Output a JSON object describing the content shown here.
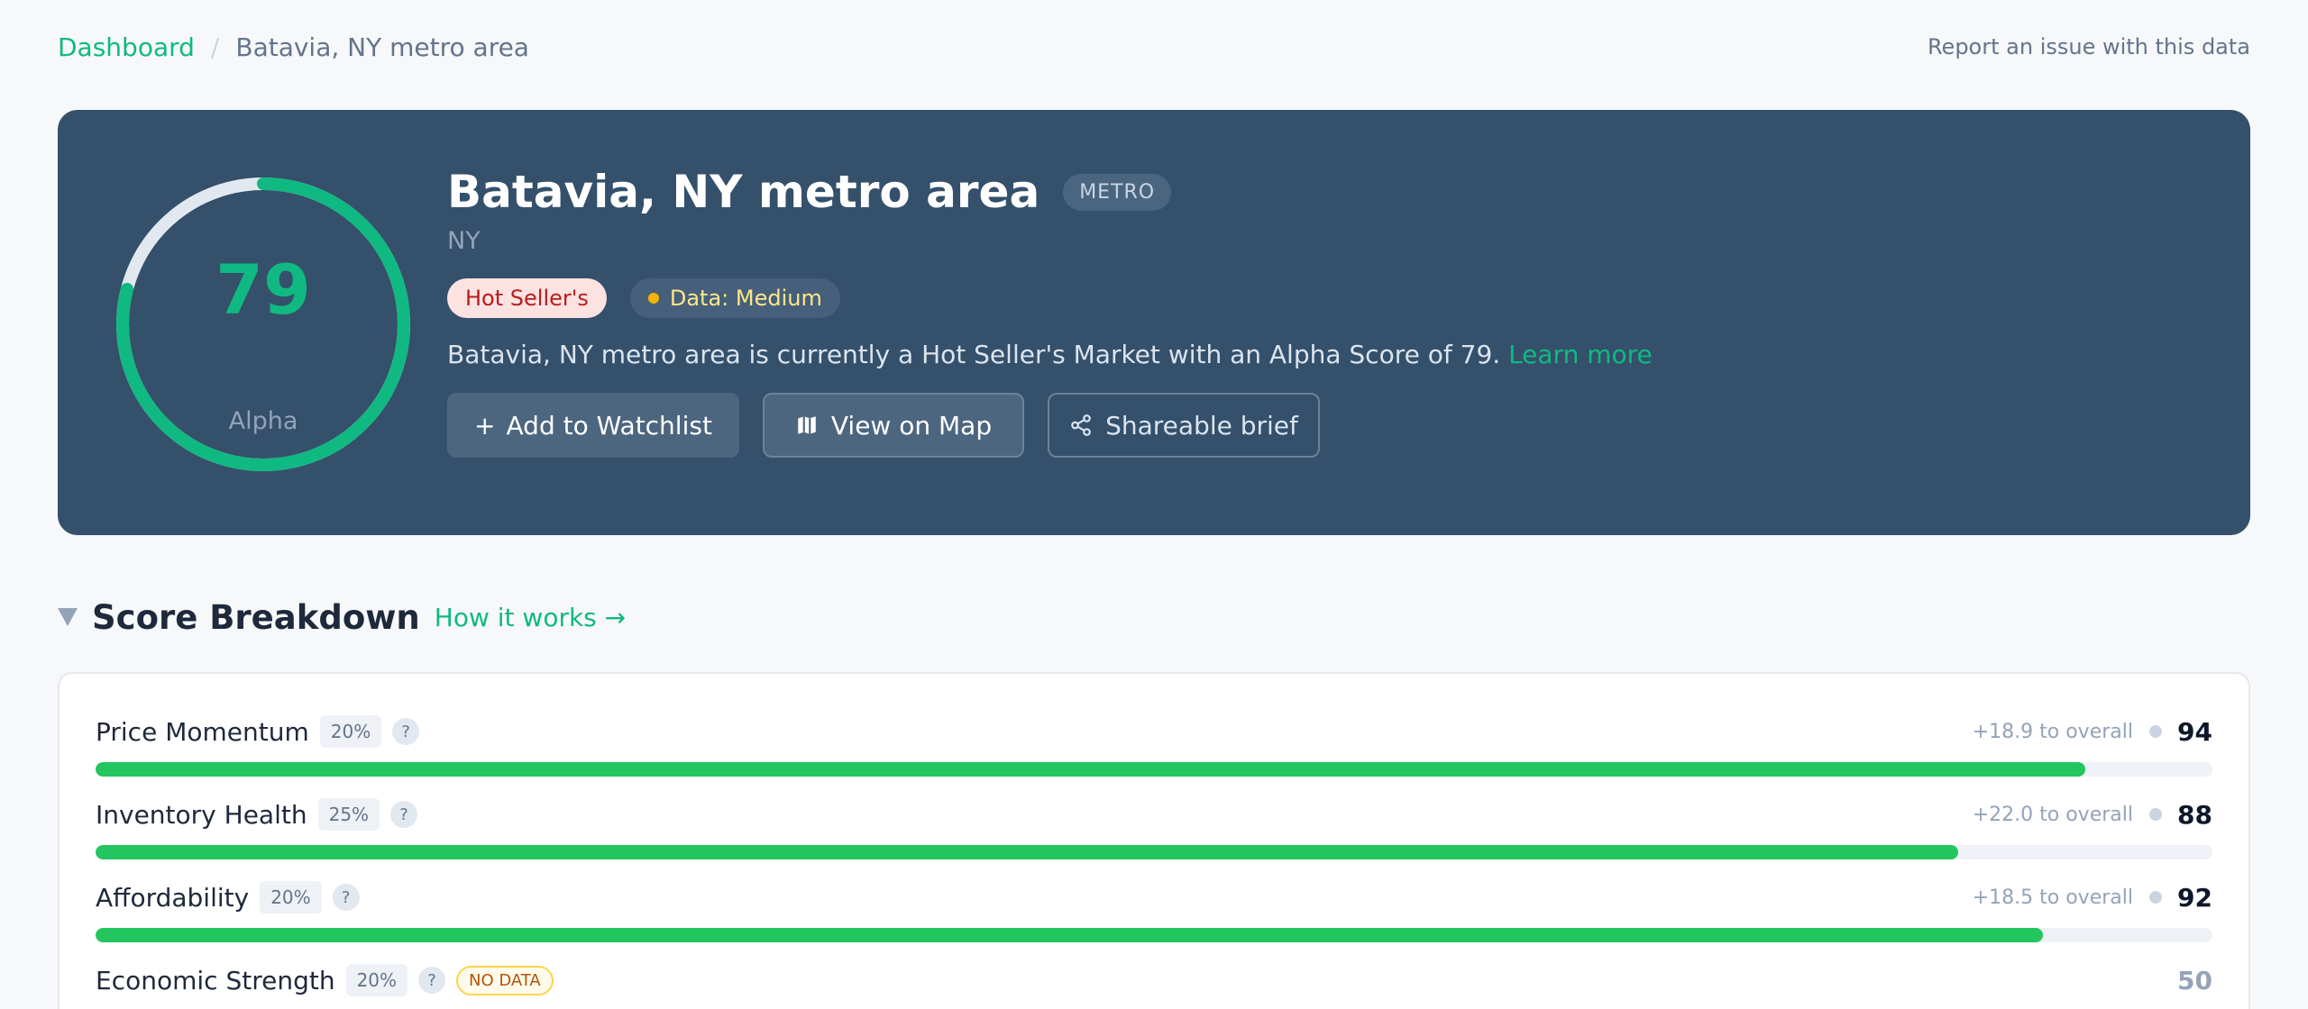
{
  "breadcrumb": {
    "home": "Dashboard",
    "separator": "/",
    "current": "Batavia, NY metro area"
  },
  "report_link": "Report an issue with this data",
  "hero": {
    "score": "79",
    "score_value": 79,
    "score_label": "Alpha",
    "title": "Batavia, NY metro area",
    "type_badge": "METRO",
    "state": "NY",
    "market_tag": "Hot Seller's",
    "data_tag": "Data: Medium",
    "description": "Batavia, NY metro area is currently a Hot Seller's Market with an Alpha Score of 79.",
    "learn_more": "Learn more",
    "buttons": {
      "watchlist": "Add to Watchlist",
      "map": "View on Map",
      "share": "Shareable brief"
    },
    "colors": {
      "accent": "#10b981",
      "background": "#34506b",
      "gauge_track": "#e2e8f0"
    }
  },
  "breakdown": {
    "title": "Score Breakdown",
    "how_link": "How it works →",
    "metrics": [
      {
        "name": "Price Momentum",
        "weight": "20%",
        "help": "?",
        "contribution": "+18.9 to overall",
        "score": "94",
        "fill": 0.94,
        "no_data": false
      },
      {
        "name": "Inventory Health",
        "weight": "25%",
        "help": "?",
        "contribution": "+22.0 to overall",
        "score": "88",
        "fill": 0.88,
        "no_data": false
      },
      {
        "name": "Affordability",
        "weight": "20%",
        "help": "?",
        "contribution": "+18.5 to overall",
        "score": "92",
        "fill": 0.92,
        "no_data": false
      },
      {
        "name": "Economic Strength",
        "weight": "20%",
        "help": "?",
        "nodata_label": "NO DATA",
        "contribution": "",
        "score": "50",
        "fill": 0,
        "no_data": true
      }
    ]
  }
}
